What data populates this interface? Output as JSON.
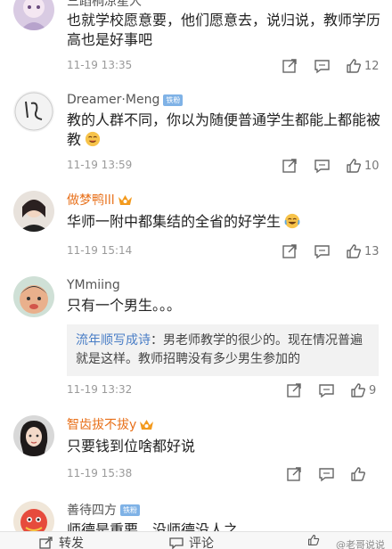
{
  "top_partial": {
    "name": "三蹈桐凉星人"
  },
  "comments": [
    {
      "name": "",
      "text": "也就学校愿意要，他们愿意去，说归说，教师学历高也是好事吧",
      "time": "11-19 13:35",
      "likes": "12"
    },
    {
      "name": "Dreamer·Meng",
      "badge": "铁粉",
      "text": "教的人群不同，你以为随便普通学生都能上都能被教",
      "emoji": "yum-face",
      "time": "11-19 13:59",
      "likes": "10"
    },
    {
      "name": "做梦鸭lll",
      "name_color": "#e8701a",
      "vip": true,
      "text": "华师一附中都集结的全省的好学生",
      "emoji": "laugh-cry-face",
      "time": "11-19 15:14",
      "likes": "13"
    },
    {
      "name": "YMmiing",
      "text": "只有一个男生。。。",
      "reply": {
        "name": "流年顺写成诗",
        "text": "：男老师教学的很少的。现在情况普遍就是这样。教师招聘没有多少男生参加的"
      },
      "time": "11-19 13:32",
      "likes": "9"
    },
    {
      "name": "智齿拔不拔y",
      "name_color": "#e8701a",
      "vip": true,
      "text": "只要钱到位啥都好说",
      "time": "11-19 15:38",
      "likes": ""
    },
    {
      "name": "善待四方",
      "badge": "铁粉",
      "text": "师德是重要，没师德没人之…"
    }
  ],
  "bottom_bar": {
    "repost_label": "转发",
    "comment_label": "评论"
  },
  "watermark": "@老哥说说",
  "colors": {
    "link_blue": "#4a7ec6",
    "vip_orange": "#e8701a",
    "badge_blue": "#7fb2e6"
  }
}
